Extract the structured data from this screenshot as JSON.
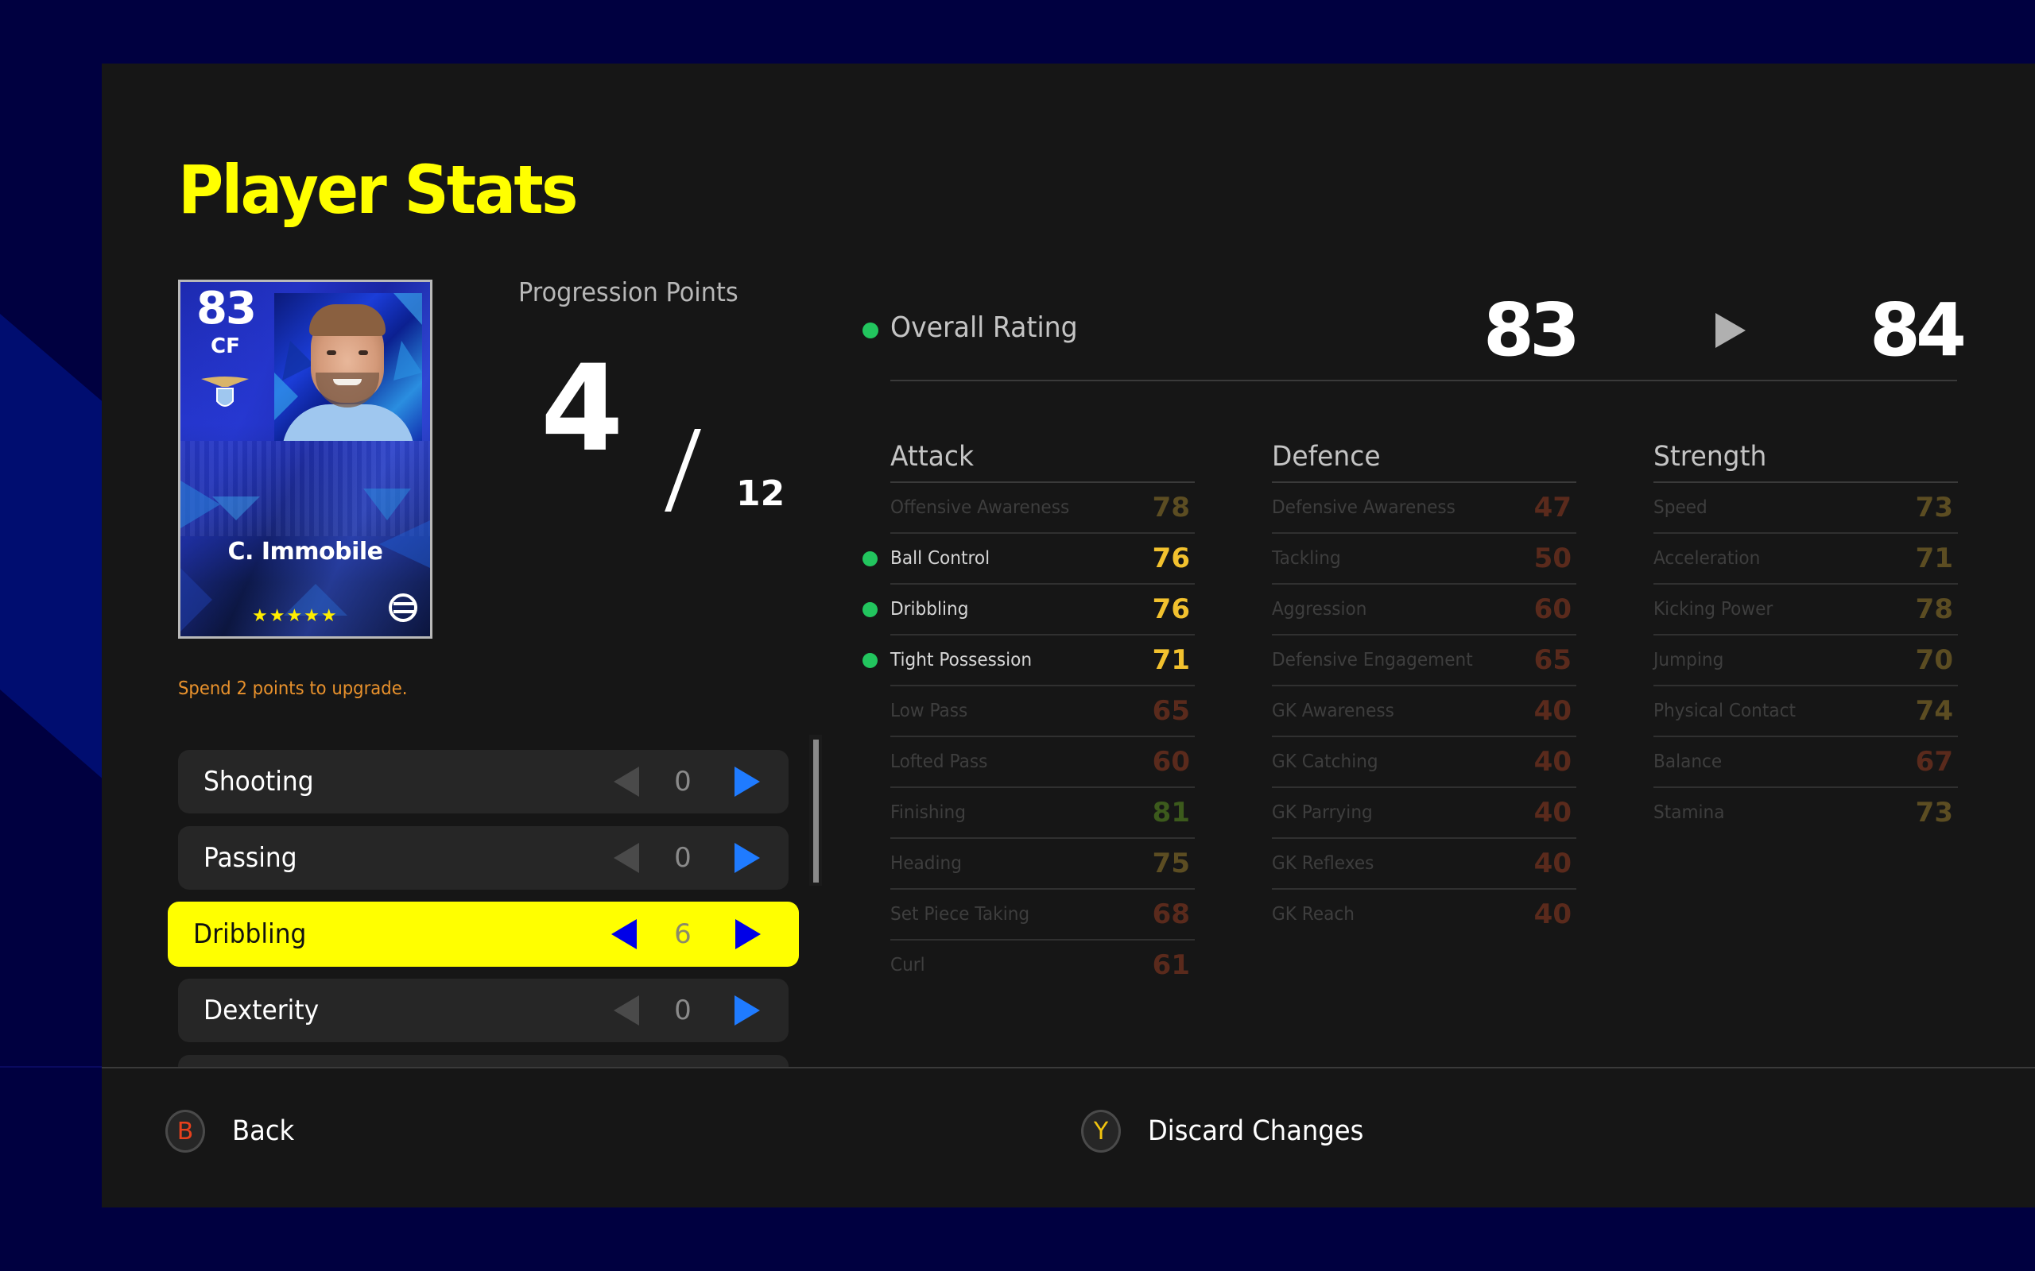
{
  "title": "Player Stats",
  "card": {
    "rating": "83",
    "position": "CF",
    "name": "C. Immobile",
    "stars": "★★★★★",
    "club_icon": "lazio-eagle-crest-icon",
    "brand_icon": "efootball-logo-icon"
  },
  "progression": {
    "label": "Progression Points",
    "current": "4",
    "max": "12"
  },
  "hint": "Spend 2 points to upgrade.",
  "skills": [
    {
      "label": "Shooting",
      "value": "0",
      "selected": false
    },
    {
      "label": "Passing",
      "value": "0",
      "selected": false
    },
    {
      "label": "Dribbling",
      "value": "6",
      "selected": true
    },
    {
      "label": "Dexterity",
      "value": "0",
      "selected": false
    }
  ],
  "overall": {
    "label": "Overall Rating",
    "current": "83",
    "new": "84"
  },
  "columns": [
    {
      "title": "Attack",
      "stats": [
        {
          "name": "Offensive Awareness",
          "value": "78",
          "active": false,
          "color": "#5c4d22"
        },
        {
          "name": "Ball Control",
          "value": "76",
          "active": true,
          "color": "#f2c12e"
        },
        {
          "name": "Dribbling",
          "value": "76",
          "active": true,
          "color": "#f2c12e"
        },
        {
          "name": "Tight Possession",
          "value": "71",
          "active": true,
          "color": "#f2c12e"
        },
        {
          "name": "Low Pass",
          "value": "65",
          "active": false,
          "color": "#5a2a1c"
        },
        {
          "name": "Lofted Pass",
          "value": "60",
          "active": false,
          "color": "#5a2a1c"
        },
        {
          "name": "Finishing",
          "value": "81",
          "active": false,
          "color": "#3c5a1c"
        },
        {
          "name": "Heading",
          "value": "75",
          "active": false,
          "color": "#5c4d22"
        },
        {
          "name": "Set Piece Taking",
          "value": "68",
          "active": false,
          "color": "#5a2a1c"
        },
        {
          "name": "Curl",
          "value": "61",
          "active": false,
          "color": "#5a2a1c"
        }
      ]
    },
    {
      "title": "Defence",
      "stats": [
        {
          "name": "Defensive Awareness",
          "value": "47",
          "active": false,
          "color": "#5a2a1c"
        },
        {
          "name": "Tackling",
          "value": "50",
          "active": false,
          "color": "#5a2a1c"
        },
        {
          "name": "Aggression",
          "value": "60",
          "active": false,
          "color": "#5a2a1c"
        },
        {
          "name": "Defensive Engagement",
          "value": "65",
          "active": false,
          "color": "#5a2a1c"
        },
        {
          "name": "GK Awareness",
          "value": "40",
          "active": false,
          "color": "#5a2a1c"
        },
        {
          "name": "GK Catching",
          "value": "40",
          "active": false,
          "color": "#5a2a1c"
        },
        {
          "name": "GK Parrying",
          "value": "40",
          "active": false,
          "color": "#5a2a1c"
        },
        {
          "name": "GK Reflexes",
          "value": "40",
          "active": false,
          "color": "#5a2a1c"
        },
        {
          "name": "GK Reach",
          "value": "40",
          "active": false,
          "color": "#5a2a1c"
        }
      ]
    },
    {
      "title": "Strength",
      "stats": [
        {
          "name": "Speed",
          "value": "73",
          "active": false,
          "color": "#5c4d22"
        },
        {
          "name": "Acceleration",
          "value": "71",
          "active": false,
          "color": "#5c4d22"
        },
        {
          "name": "Kicking Power",
          "value": "78",
          "active": false,
          "color": "#5c4d22"
        },
        {
          "name": "Jumping",
          "value": "70",
          "active": false,
          "color": "#5c4d22"
        },
        {
          "name": "Physical Contact",
          "value": "74",
          "active": false,
          "color": "#5c4d22"
        },
        {
          "name": "Balance",
          "value": "67",
          "active": false,
          "color": "#5a2a1c"
        },
        {
          "name": "Stamina",
          "value": "73",
          "active": false,
          "color": "#5c4d22"
        }
      ]
    }
  ],
  "footer": {
    "back": {
      "key": "B",
      "label": "Back",
      "key_color": "#e8401c"
    },
    "discard": {
      "key": "Y",
      "label": "Discard Changes",
      "key_color": "#f2c40e"
    }
  },
  "colors": {
    "accent_yellow": "#ffff00",
    "background_navy": "#000040",
    "panel": "#161616",
    "active_dot": "#22c55e",
    "increment_arrow": "#1f7bff"
  }
}
